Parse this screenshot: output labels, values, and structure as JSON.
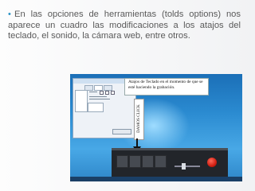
{
  "slide": {
    "bullet": "•",
    "body": "En las opciones de herramientas (tolds options) nos aparece un cuadro las modificaciones a los atajos del teclado, el sonido, la cámara web, entre otros."
  },
  "screenshot": {
    "callout_text": "Atajos de Teclado en el momento de que se esté haciendo la grabación.",
    "vertical_label": "DAMOS CLICK"
  },
  "colors": {
    "accent": "#2d94c6",
    "desktop": "#2a8ad0",
    "record": "#d11f12"
  },
  "icons": [
    "record-icon",
    "arrow-down-icon"
  ]
}
